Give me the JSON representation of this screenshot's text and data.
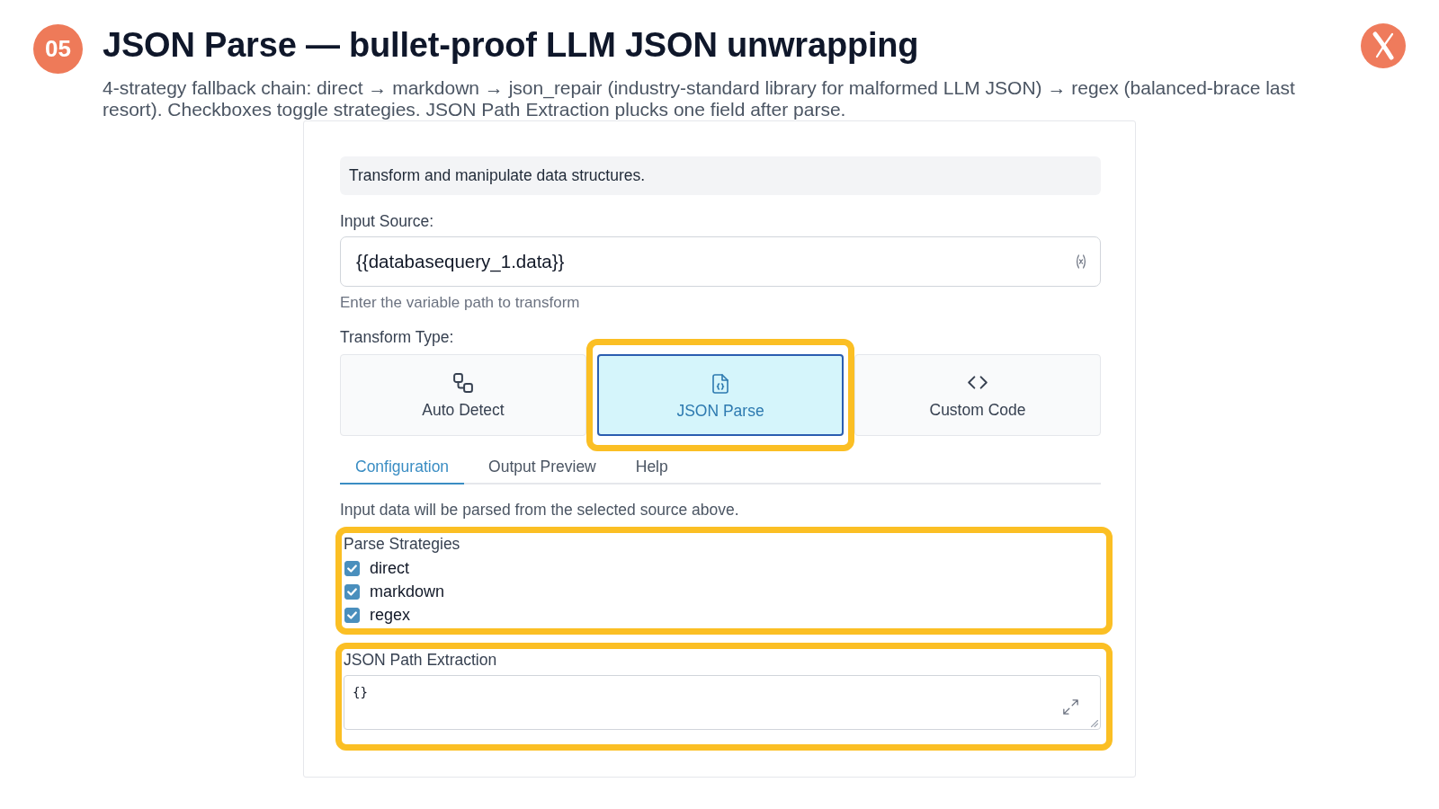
{
  "slide": {
    "number": "05",
    "title": "JSON Parse — bullet-proof LLM JSON unwrapping",
    "subtitle": "4-strategy fallback chain: direct → markdown → json_repair (industry-standard library for malformed LLM JSON) → regex (balanced-brace last resort). Checkboxes toggle strategies. JSON Path Extraction plucks one field after parse."
  },
  "panel": {
    "description": "Transform and manipulate data structures.",
    "input_source": {
      "label": "Input Source:",
      "value": "{{databasequery_1.data}}",
      "hint": "Enter the variable path to transform"
    },
    "transform_type": {
      "label": "Transform Type:",
      "options": [
        {
          "label": "Auto Detect",
          "selected": false,
          "highlighted": false
        },
        {
          "label": "JSON Parse",
          "selected": true,
          "highlighted": true
        },
        {
          "label": "Custom Code",
          "selected": false,
          "highlighted": false
        }
      ]
    },
    "tabs": [
      {
        "label": "Configuration",
        "selected": true
      },
      {
        "label": "Output Preview",
        "selected": false
      },
      {
        "label": "Help",
        "selected": false
      }
    ],
    "config": {
      "note": "Input data will be parsed from the selected source above.",
      "sections": [
        {
          "kind": "checkboxes",
          "label": "Parse Strategies",
          "highlighted": true,
          "items": [
            {
              "label": "direct",
              "checked": true
            },
            {
              "label": "markdown",
              "checked": true
            },
            {
              "label": "regex",
              "checked": true
            }
          ]
        },
        {
          "kind": "code_field",
          "label": "JSON Path Extraction",
          "highlighted": true,
          "value": "{}"
        }
      ]
    }
  }
}
